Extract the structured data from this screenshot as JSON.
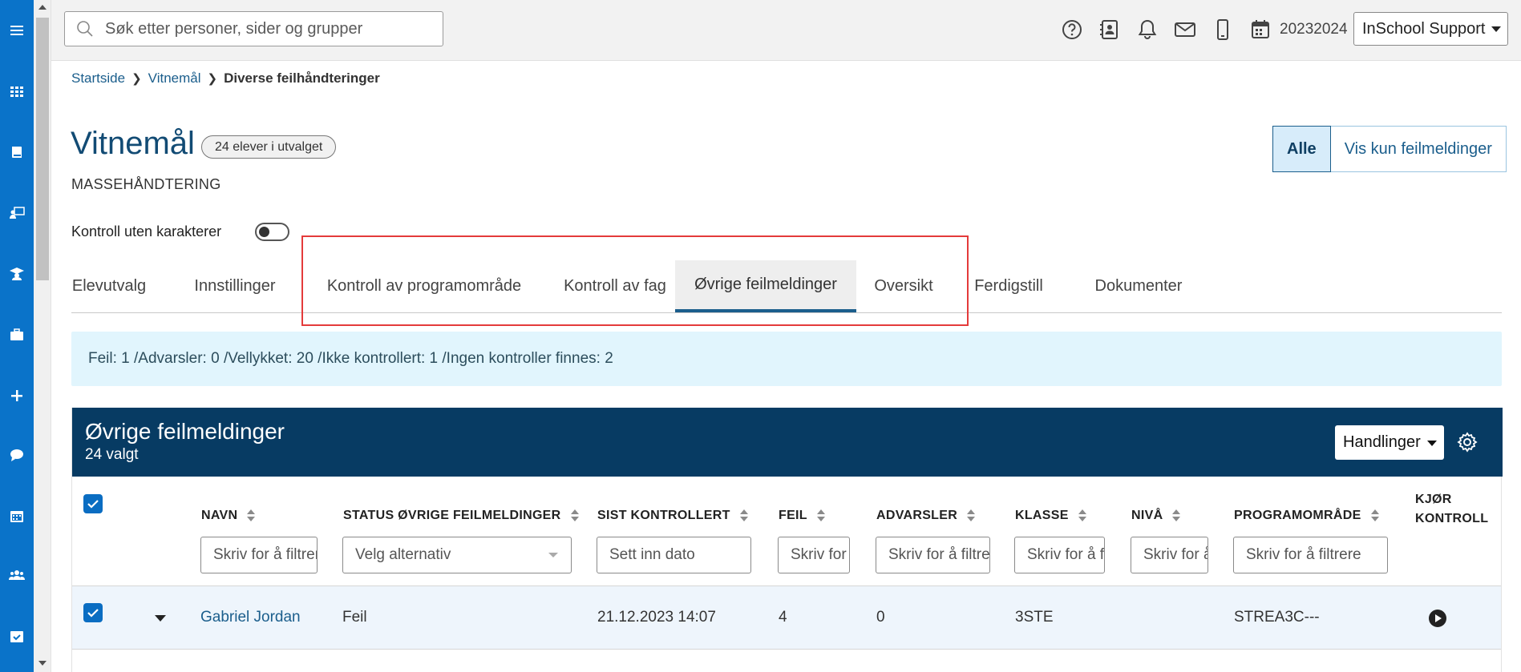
{
  "topbar": {
    "search_placeholder": "Søk etter personer, sider og grupper",
    "school_year": "20232024",
    "school_select": "InSchool Support",
    "icons": [
      "help-icon",
      "contact-card-icon",
      "bell-icon",
      "mail-icon",
      "mobile-icon",
      "calendar-icon"
    ]
  },
  "nav_rail": {
    "items": [
      "menu-icon",
      "grid-icon",
      "book-icon",
      "teacher-icon",
      "graduation-icon",
      "briefcase-icon",
      "plus-icon",
      "chat-icon",
      "calendar-icon",
      "group-icon",
      "calendar-check-icon"
    ]
  },
  "breadcrumb": {
    "items": [
      {
        "label": "Startside"
      },
      {
        "label": "Vitnemål"
      }
    ],
    "current": "Diverse feilhåndteringer"
  },
  "page": {
    "title": "Vitnemål",
    "count_badge": "24 elever i utvalget",
    "subtitle": "MASSEHÅNDTERING",
    "filter_toggle": {
      "options": [
        "Alle",
        "Vis kun feilmeldinger"
      ],
      "selected": "Alle"
    },
    "control_toggle": {
      "label": "Kontroll uten karakterer",
      "value": false
    }
  },
  "tabs": {
    "items": [
      {
        "label": "Elevutvalg"
      },
      {
        "label": "Innstillinger"
      },
      {
        "label": "Kontroll av programområde"
      },
      {
        "label": "Kontroll av fag"
      },
      {
        "label": "Øvrige feilmeldinger"
      },
      {
        "label": "Oversikt"
      },
      {
        "label": "Ferdigstill"
      },
      {
        "label": "Dokumenter"
      }
    ],
    "active": "Øvrige feilmeldinger"
  },
  "alert": {
    "text": "Feil: 1 /Advarsler: 0 /Vellykket: 20 /Ikke kontrollert: 1 /Ingen kontroller finnes: 2"
  },
  "panel": {
    "title": "Øvrige feilmeldinger",
    "selected_count": "24 valgt",
    "actions_label": "Handlinger",
    "columns": [
      {
        "label": "NAVN",
        "filter": "Skriv for å filtrere"
      },
      {
        "label": "STATUS ØVRIGE FEILMELDINGER",
        "filter": "Velg alternativ"
      },
      {
        "label": "SIST KONTROLLERT",
        "filter": "Sett inn dato"
      },
      {
        "label": "FEIL",
        "filter": "Skriv for å filtrere"
      },
      {
        "label": "ADVARSLER",
        "filter": "Skriv for å filtrere"
      },
      {
        "label": "KLASSE",
        "filter": "Skriv for å filtrere"
      },
      {
        "label": "NIVÅ",
        "filter": "Skriv for å filtrere"
      },
      {
        "label": "PROGRAMOMRÅDE",
        "filter": "Skriv for å filtrere"
      },
      {
        "label": "KJØR KONTROLL",
        "filter": ""
      }
    ],
    "rows": [
      {
        "checked": true,
        "name": "Gabriel Jordan",
        "status": "Feil",
        "last_checked": "21.12.2023 14:07",
        "errors": "4",
        "warnings": "0",
        "class": "3STE",
        "level": "",
        "program_area": "STREA3C---"
      }
    ]
  }
}
